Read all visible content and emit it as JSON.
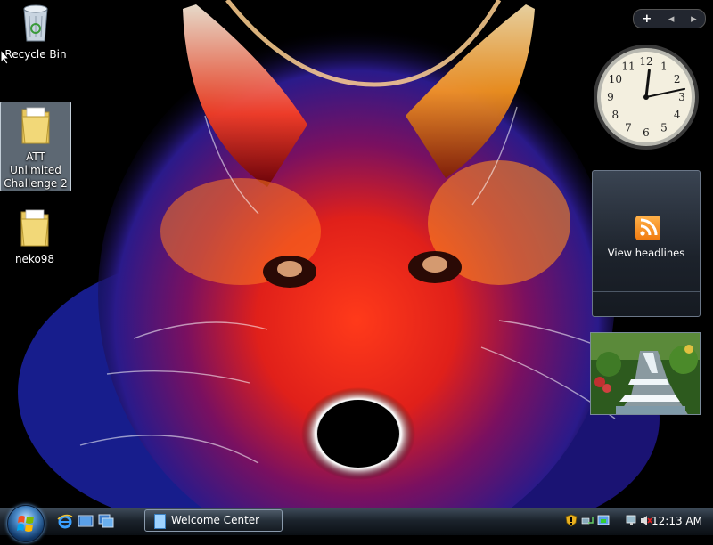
{
  "desktop": {
    "icons": [
      {
        "label": "Recycle Bin",
        "icon": "recycle-bin-icon"
      },
      {
        "label": "ATT Unlimited Challenge 2",
        "line1": "ATT",
        "line2": "Unlimited",
        "line3": "Challenge 2",
        "icon": "folder-icon",
        "selected": true
      },
      {
        "label": "neko98",
        "icon": "folder-icon"
      }
    ]
  },
  "sidebar": {
    "toolbar": {
      "add": "+",
      "prev": "◂",
      "next": "▸"
    },
    "clock": {
      "hour": 12,
      "minute": 13,
      "numerals": [
        "12",
        "1",
        "2",
        "3",
        "4",
        "5",
        "6",
        "7",
        "8",
        "9",
        "10",
        "11"
      ]
    },
    "feed": {
      "label": "View headlines",
      "icon": "rss-icon"
    },
    "slideshow": {
      "icon": "waterfall-photo"
    }
  },
  "taskbar": {
    "start_icon": "windows-start-orb",
    "quicklaunch": [
      "internet-explorer-icon",
      "show-desktop-icon",
      "switch-windows-icon"
    ],
    "tasks": [
      {
        "label": "Welcome Center",
        "icon": "welcome-center-icon"
      }
    ],
    "tray_icons": [
      "security-shield-icon",
      "network-icon",
      "windows-update-icon",
      "display-icon",
      "volume-muted-icon"
    ],
    "clock": "12:13 AM"
  }
}
